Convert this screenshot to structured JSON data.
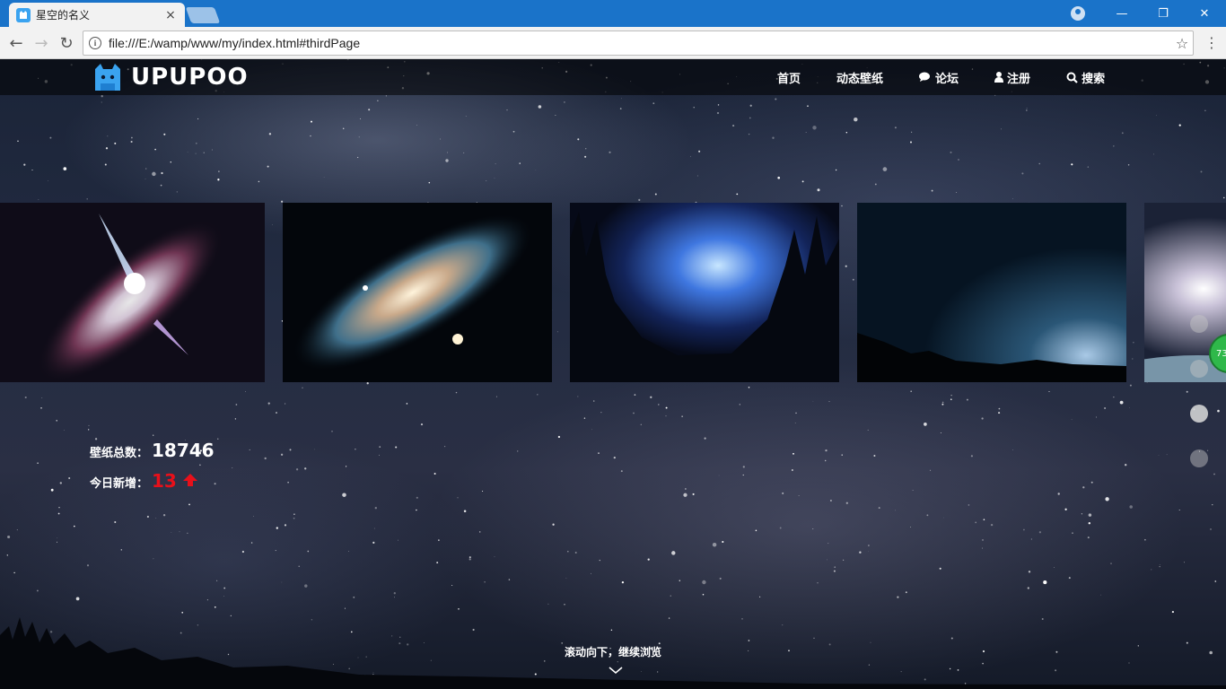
{
  "browser": {
    "tab_title": "星空的名义",
    "tab_close": "×",
    "address": "file:///E:/wamp/www/my/index.html#thirdPage",
    "back_glyph": "←",
    "forward_glyph": "→",
    "reload_glyph": "↻",
    "info_glyph": "i",
    "star_glyph": "☆",
    "menu_glyph": "⋮",
    "minimize_glyph": "—",
    "restore_glyph": "❐",
    "close_glyph": "✕"
  },
  "site": {
    "logo_text": "UPUPOO",
    "nav": [
      {
        "label": "首页",
        "icon": ""
      },
      {
        "label": "动态壁纸",
        "icon": ""
      },
      {
        "label": "论坛",
        "icon": "comments-icon"
      },
      {
        "label": "注册",
        "icon": "user-icon"
      },
      {
        "label": "搜索",
        "icon": "search-icon"
      }
    ],
    "slides": [
      {
        "name": "galaxy-jet"
      },
      {
        "name": "spiral-galaxy"
      },
      {
        "name": "blue-forest-nebula"
      },
      {
        "name": "mountain-horizon"
      },
      {
        "name": "planet-glow"
      }
    ],
    "stats": {
      "total_label": "壁纸总数：",
      "total_value": "18746",
      "today_label": "今日新增：",
      "today_value": "13",
      "today_arrow": "🡅"
    },
    "badge_text": "73",
    "scroll_hint": "滚动向下，继续浏览",
    "pages_count": 4,
    "active_page": 3
  },
  "colors": {
    "titlebar": "#1a73c9",
    "accent_red": "#e8101a",
    "badge_green": "#2fb84a"
  }
}
